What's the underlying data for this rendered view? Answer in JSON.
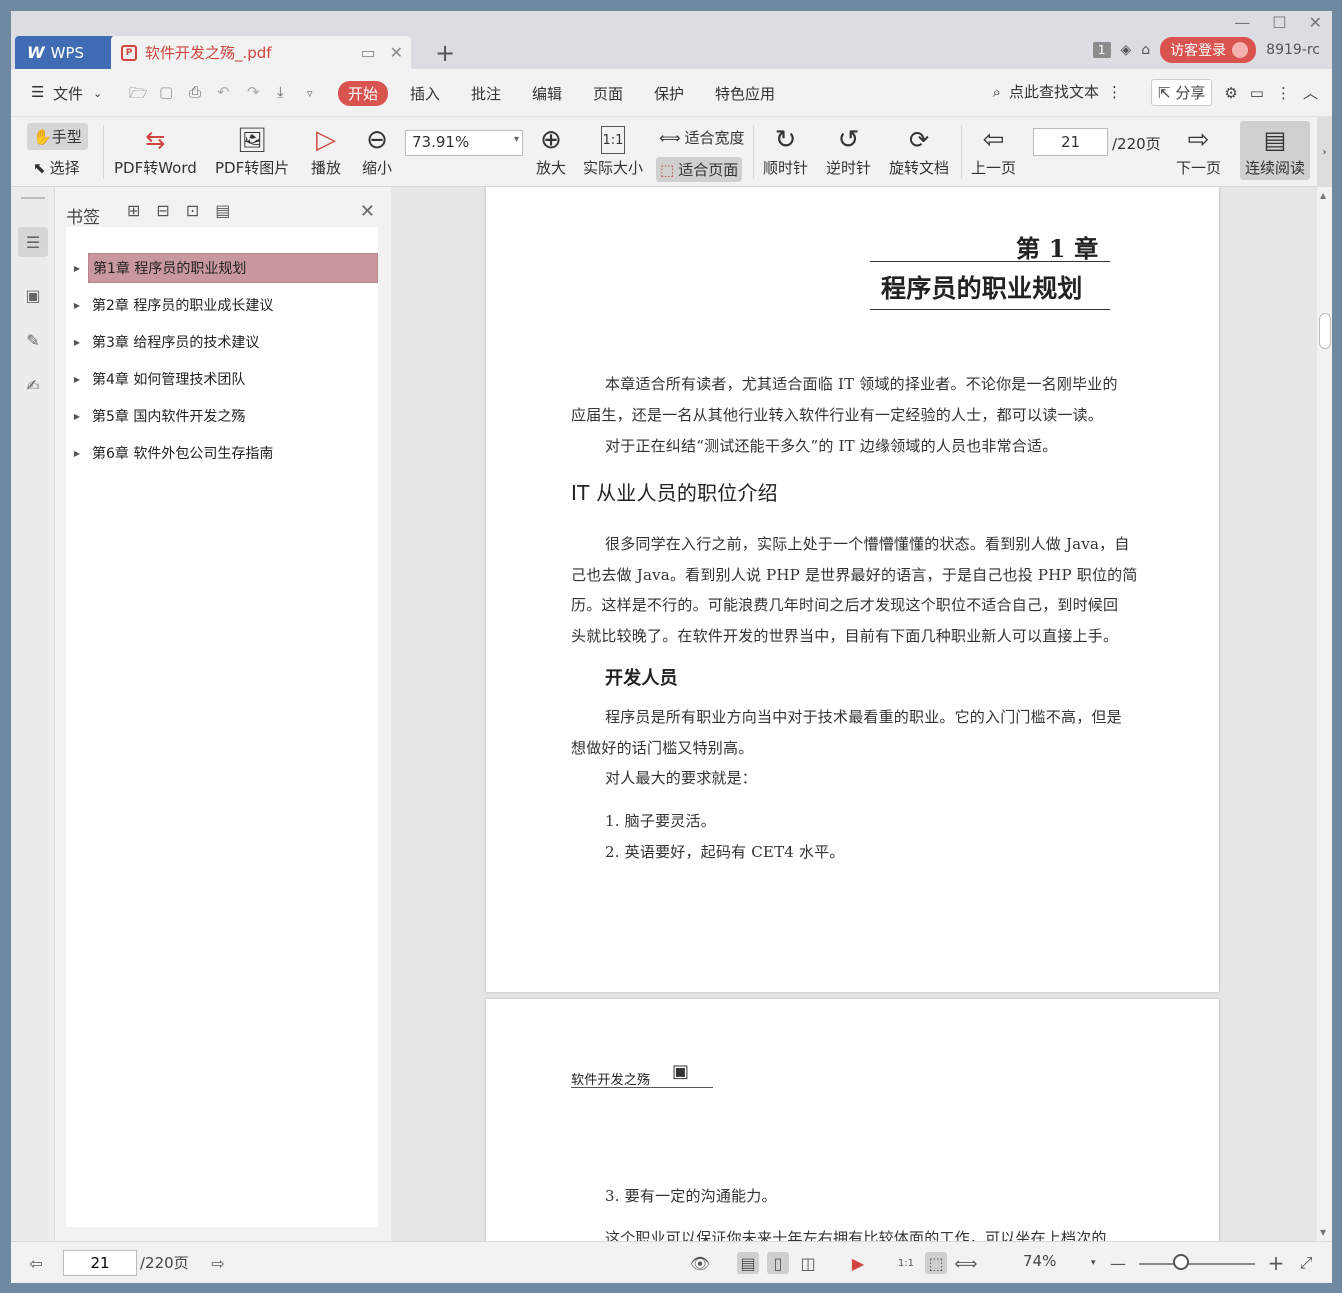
{
  "titlebar": {
    "wps_tab": "WPS",
    "doc_tab": "软件开发之殇_.pdf",
    "badge": "1",
    "guest_login": "访客登录",
    "user": "8919-rc"
  },
  "menu": {
    "items": [
      "文件",
      "开始",
      "插入",
      "批注",
      "编辑",
      "页面",
      "保护",
      "特色应用"
    ],
    "search": "点此查找文本",
    "share": "分享"
  },
  "toolbar": {
    "hand": "手型",
    "select": "选择",
    "pdf_word": "PDF转Word",
    "pdf_img": "PDF转图片",
    "play": "播放",
    "zoom_out": "缩小",
    "zoom_value": "73.91%",
    "zoom_in": "放大",
    "actual": "实际大小",
    "fit_width": "适合宽度",
    "fit_page": "适合页面",
    "cw": "顺时针",
    "ccw": "逆时针",
    "rotate": "旋转文档",
    "prev": "上一页",
    "page": "21",
    "total": "/220页",
    "next": "下一页",
    "continuous": "连续阅读"
  },
  "bookmarks": {
    "title": "书签",
    "items": [
      "第1章 程序员的职业规划",
      "第2章 程序员的职业成长建议",
      "第3章 给程序员的技术建议",
      "第4章 如何管理技术团队",
      "第5章 国内软件开发之殇",
      "第6章 软件外包公司生存指南"
    ]
  },
  "page1": {
    "chapter": "第 1 章",
    "chapter_title": "程序员的职业规划",
    "p1a": "本章适合所有读者，尤其适合面临 IT 领域的择业者。不论你是一名刚毕业的",
    "p1b": "应届生，还是一名从其他行业转入软件行业有一定经验的人士，都可以读一读。",
    "p2": "对于正在纠结“测试还能干多久”的 IT 边缘领域的人员也非常合适。",
    "h1": "IT 从业人员的职位介绍",
    "p3a": "很多同学在入行之前，实际上处于一个懵懵懂懂的状态。看到别人做 Java，自",
    "p3b": "己也去做 Java。看到别人说 PHP 是世界最好的语言，于是自己也投 PHP 职位的简",
    "p3c": "历。这样是不行的。可能浪费几年时间之后才发现这个职位不适合自己，到时候回",
    "p3d": "头就比较晚了。在软件开发的世界当中，目前有下面几种职业新人可以直接上手。",
    "h2": "开发人员",
    "p4a": "程序员是所有职业方向当中对于技术最看重的职业。它的入门门槛不高，但是",
    "p4b": "想做好的话门槛又特别高。",
    "p5": "对人最大的要求就是：",
    "li1": "1. 脑子要灵活。",
    "li2": "2. 英语要好，起码有 CET4 水平。"
  },
  "page2": {
    "header": "软件开发之殇",
    "li3": "3. 要有一定的沟通能力。",
    "cut": "这个职业可以保证你未来十年左右拥有比较体面的工作，可以坐在上档次的"
  },
  "status": {
    "page": "21",
    "total": "/220页",
    "zoom": "74%"
  }
}
